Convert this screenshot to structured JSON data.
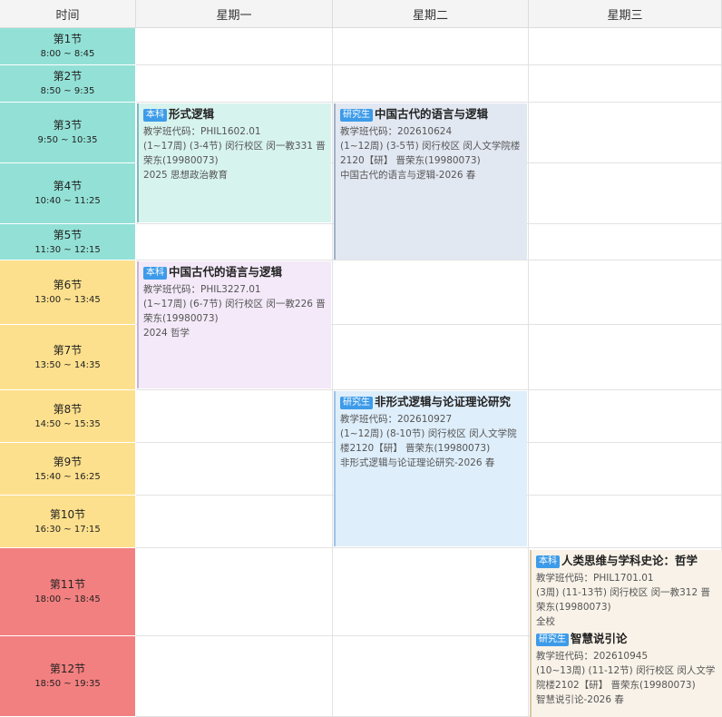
{
  "headers": {
    "time": "时间",
    "mon": "星期一",
    "tue": "星期二",
    "wed": "星期三"
  },
  "slots": [
    {
      "name": "第1节",
      "time": "8:00 ~ 8:45"
    },
    {
      "name": "第2节",
      "time": "8:50 ~ 9:35"
    },
    {
      "name": "第3节",
      "time": "9:50 ~ 10:35"
    },
    {
      "name": "第4节",
      "time": "10:40 ~ 11:25"
    },
    {
      "name": "第5节",
      "time": "11:30 ~ 12:15"
    },
    {
      "name": "第6节",
      "time": "13:00 ~ 13:45"
    },
    {
      "name": "第7节",
      "time": "13:50 ~ 14:35"
    },
    {
      "name": "第8节",
      "time": "14:50 ~ 15:35"
    },
    {
      "name": "第9节",
      "time": "15:40 ~ 16:25"
    },
    {
      "name": "第10节",
      "time": "16:30 ~ 17:15"
    },
    {
      "name": "第11节",
      "time": "18:00 ~ 18:45"
    },
    {
      "name": "第12节",
      "time": "18:50 ~ 19:35"
    }
  ],
  "colors": {
    "morning": "#93e1d6",
    "afternoon": "#fde08d",
    "evening": "#f38080",
    "tag": "#3d9be9"
  },
  "courses": [
    {
      "tag": "本科",
      "name": "形式逻辑",
      "code": "教学班代码：PHIL1602.01",
      "detail": "(1~17周) (3-4节) 闵行校区 闵一教331  晋荣东(19980073)",
      "extra": "2025 思想政治教育",
      "bg": "#d7f3ee"
    },
    {
      "tag": "研究生",
      "name": "中国古代的语言与逻辑",
      "code": "教学班代码：202610624",
      "detail": "(1~12周) (3-5节) 闵行校区 闵人文学院楼2120【研】 晋荣东(19980073)",
      "extra": "中国古代的语言与逻辑-2026 春",
      "bg": "#e2e8f2"
    },
    {
      "tag": "本科",
      "name": "中国古代的语言与逻辑",
      "code": "教学班代码：PHIL3227.01",
      "detail": "(1~17周) (6-7节) 闵行校区 闵一教226  晋荣东(19980073)",
      "extra": "2024 哲学",
      "bg": "#f3e9f8"
    },
    {
      "tag": "研究生",
      "name": "非形式逻辑与论证理论研究",
      "code": "教学班代码：202610927",
      "detail": "(1~12周) (8-10节) 闵行校区 闵人文学院楼2120【研】 晋荣东(19980073)",
      "extra": "非形式逻辑与论证理论研究-2026 春",
      "bg": "#deeefb"
    },
    {
      "tag": "本科",
      "name": "人类思维与学科史论：哲学",
      "code": "教学班代码：PHIL1701.01",
      "detail": "(3周) (11-13节) 闵行校区 闵一教312  晋荣东(19980073)",
      "extra": "全校",
      "bg": "#f8f2e8"
    },
    {
      "tag": "研究生",
      "name": "智慧说引论",
      "code": "教学班代码：202610945",
      "detail": "(10~13周) (11-12节) 闵行校区 闵人文学院楼2102【研】 晋荣东(19980073)",
      "extra": "智慧说引论-2026 春",
      "bg": "#f8f2e8"
    }
  ]
}
